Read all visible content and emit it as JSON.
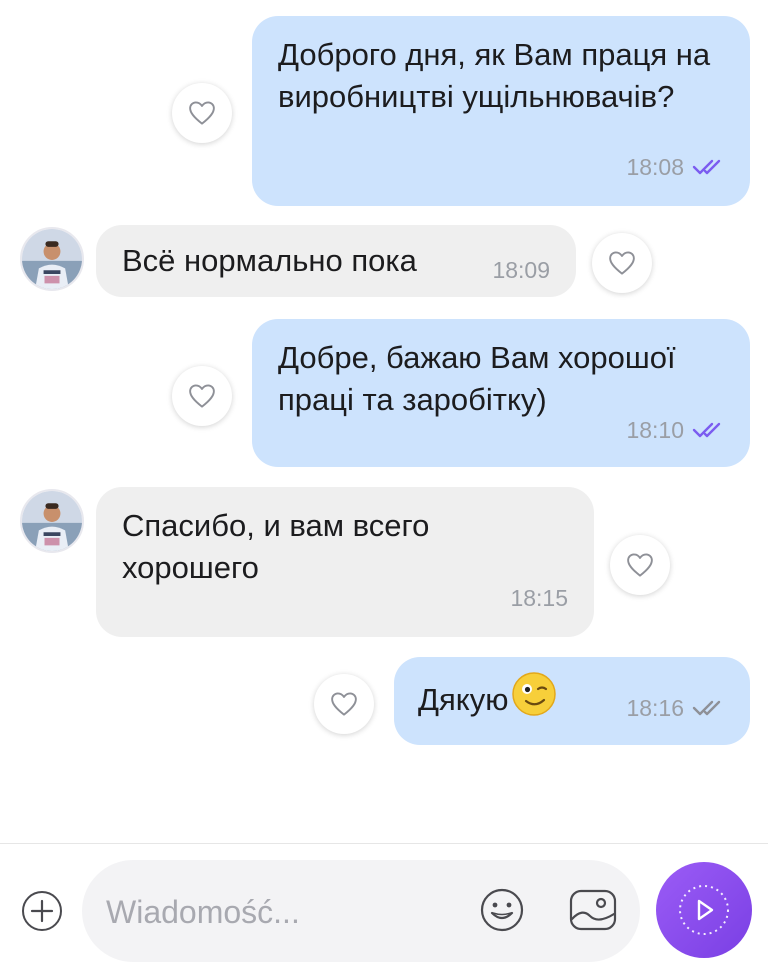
{
  "conversation": {
    "messages": [
      {
        "direction": "outgoing",
        "text": "Доброго дня, як Вам праця на виробництві ущільнювачів?",
        "time": "18:08",
        "status": "read"
      },
      {
        "direction": "incoming",
        "text": "Всё нормально пока",
        "time": "18:09"
      },
      {
        "direction": "outgoing",
        "text": "Добре, бажаю Вам хорошої праці та заробітку)",
        "time": "18:10",
        "status": "read"
      },
      {
        "direction": "incoming",
        "text": "Спасибо, и вам всего хорошего",
        "time": "18:15"
      },
      {
        "direction": "outgoing",
        "text": "Дякую",
        "emoji": "winking-face",
        "time": "18:16",
        "status": "delivered"
      }
    ]
  },
  "composer": {
    "placeholder": "Wiadomość..."
  },
  "colors": {
    "outgoing_bubble": "#cde3fd",
    "incoming_bubble": "#efefef",
    "read_ticks": "#7b5cf0",
    "delivered_ticks": "#8e9097",
    "send_button": "#8b4cf0"
  }
}
